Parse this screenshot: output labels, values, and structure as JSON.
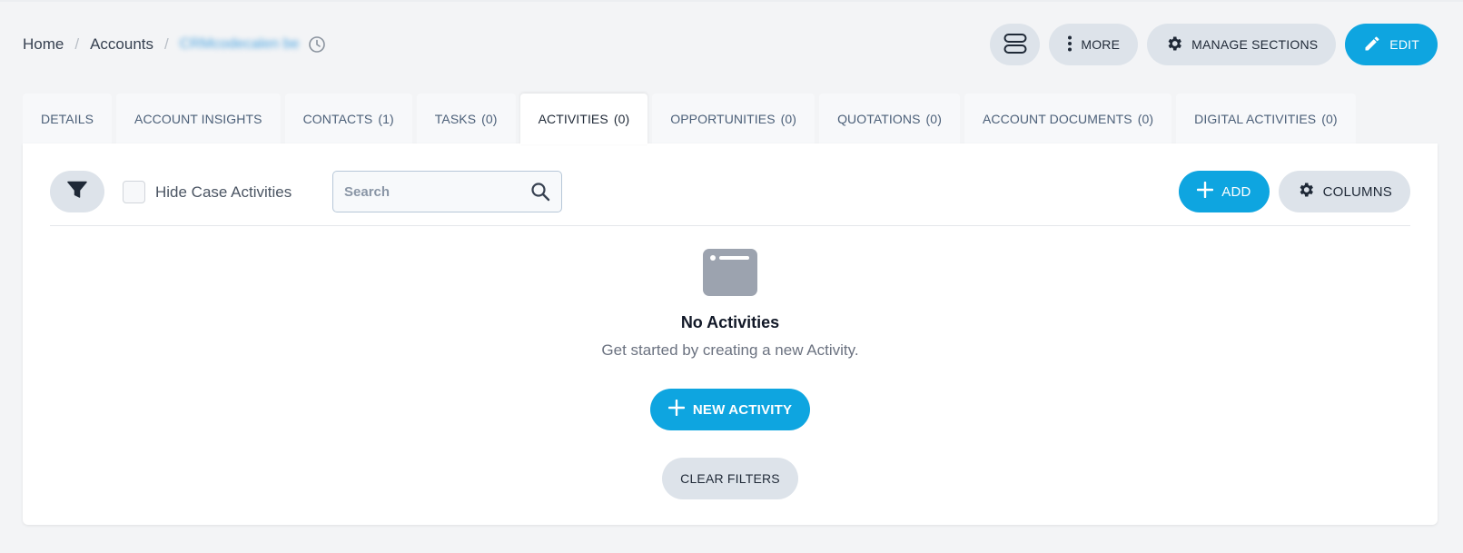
{
  "breadcrumb": {
    "home": "Home",
    "accounts": "Accounts",
    "record": "CRMcodecalen be"
  },
  "header": {
    "more_label": "MORE",
    "manage_sections_label": "MANAGE SECTIONS",
    "edit_label": "EDIT"
  },
  "tabs": [
    {
      "label": "DETAILS",
      "count": ""
    },
    {
      "label": "ACCOUNT INSIGHTS",
      "count": ""
    },
    {
      "label": "CONTACTS",
      "count": "(1)"
    },
    {
      "label": "TASKS",
      "count": "(0)"
    },
    {
      "label": "ACTIVITIES",
      "count": "(0)"
    },
    {
      "label": "OPPORTUNITIES",
      "count": "(0)"
    },
    {
      "label": "QUOTATIONS",
      "count": "(0)"
    },
    {
      "label": "ACCOUNT DOCUMENTS",
      "count": "(0)"
    },
    {
      "label": "DIGITAL ACTIVITIES",
      "count": "(0)"
    }
  ],
  "toolbar": {
    "hide_case_label": "Hide Case Activities",
    "search_placeholder": "Search",
    "add_label": "ADD",
    "columns_label": "COLUMNS"
  },
  "empty_state": {
    "title": "No Activities",
    "subtitle": "Get started by creating a new Activity.",
    "new_button": "NEW ACTIVITY",
    "clear_filters": "CLEAR FILTERS"
  },
  "colors": {
    "primary": "#0ea5e0",
    "secondary_button": "#dde3ea",
    "background": "#f3f4f6"
  },
  "icons": [
    "history-icon",
    "layout-toggle-icon",
    "vertical-dots-icon",
    "gear-icon",
    "pencil-icon",
    "filter-icon",
    "search-icon",
    "plus-icon",
    "empty-window-icon"
  ]
}
